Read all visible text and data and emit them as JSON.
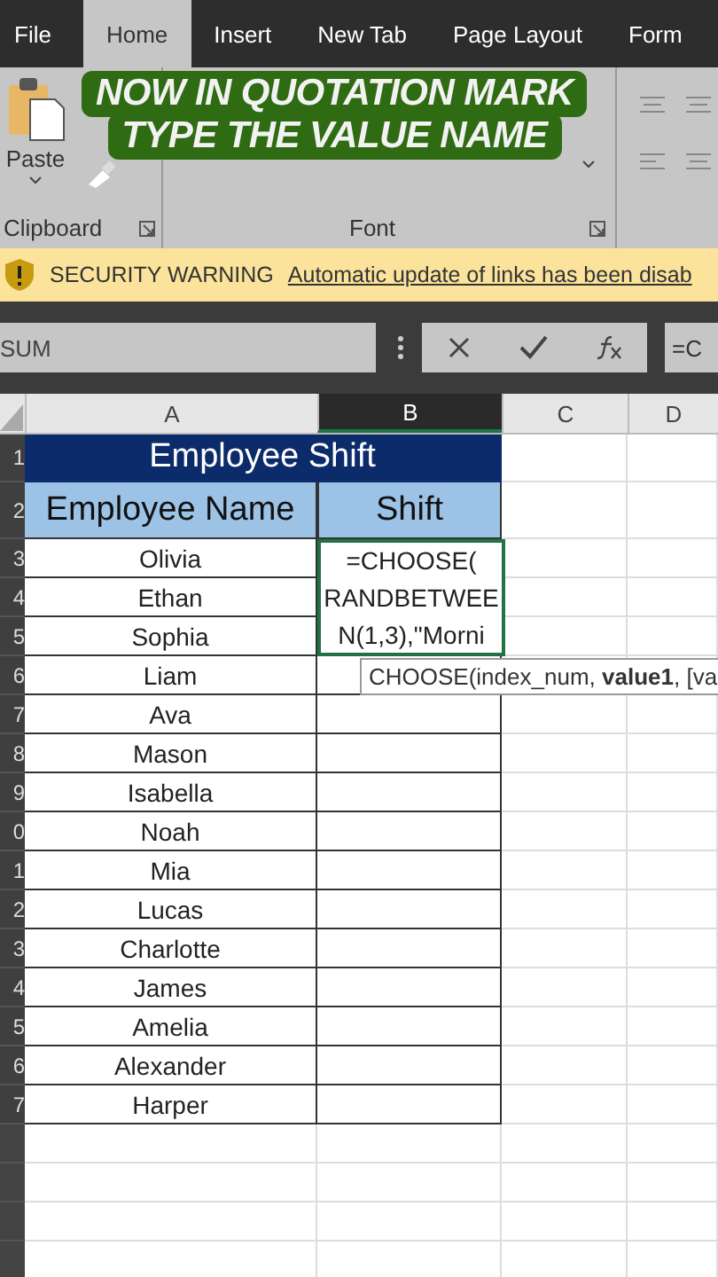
{
  "tabs": [
    {
      "label": "File",
      "selected": false
    },
    {
      "label": "Home",
      "selected": true
    },
    {
      "label": "Insert",
      "selected": false
    },
    {
      "label": "New Tab",
      "selected": false
    },
    {
      "label": "Page Layout",
      "selected": false
    },
    {
      "label": "Form",
      "selected": false
    }
  ],
  "caption": [
    "NOW IN QUOTATION MARK",
    "TYPE THE VALUE NAME"
  ],
  "ribbon": {
    "paste_label": "Paste",
    "groups": [
      "Clipboard",
      "Font"
    ]
  },
  "security_bar": {
    "title": "SECURITY WARNING",
    "message": "Automatic update of links has been disab"
  },
  "formula_bar": {
    "name_box": "SUM",
    "formula": "=C"
  },
  "columns": [
    {
      "label": "A",
      "selected": false
    },
    {
      "label": "B",
      "selected": true
    },
    {
      "label": "C",
      "selected": false
    },
    {
      "label": "D",
      "selected": false
    }
  ],
  "title_row": {
    "row": "1",
    "text": "Employee Shift"
  },
  "header_row": {
    "row": "2",
    "name": "Employee Name",
    "shift": "Shift"
  },
  "rows": [
    {
      "row": "3",
      "name": "Olivia",
      "shift": "=CHOOSE("
    },
    {
      "row": "4",
      "name": "Ethan",
      "shift": "RANDBETWEE"
    },
    {
      "row": "5",
      "name": "Sophia",
      "shift": "N(1,3),\"Morni"
    },
    {
      "row": "6",
      "name": "Liam"
    },
    {
      "row": "7",
      "name": "Ava"
    },
    {
      "row": "8",
      "name": "Mason"
    },
    {
      "row": "9",
      "name": "Isabella"
    },
    {
      "row": "0",
      "name": "Noah"
    },
    {
      "row": "1",
      "name": "Mia"
    },
    {
      "row": "2",
      "name": "Lucas"
    },
    {
      "row": "3",
      "name": "Charlotte"
    },
    {
      "row": "4",
      "name": "James"
    },
    {
      "row": "5",
      "name": "Amelia"
    },
    {
      "row": "6",
      "name": "Alexander"
    },
    {
      "row": "7",
      "name": "Harper"
    }
  ],
  "tooltip": "CHOOSE(index_num, **value1**, [va"
}
